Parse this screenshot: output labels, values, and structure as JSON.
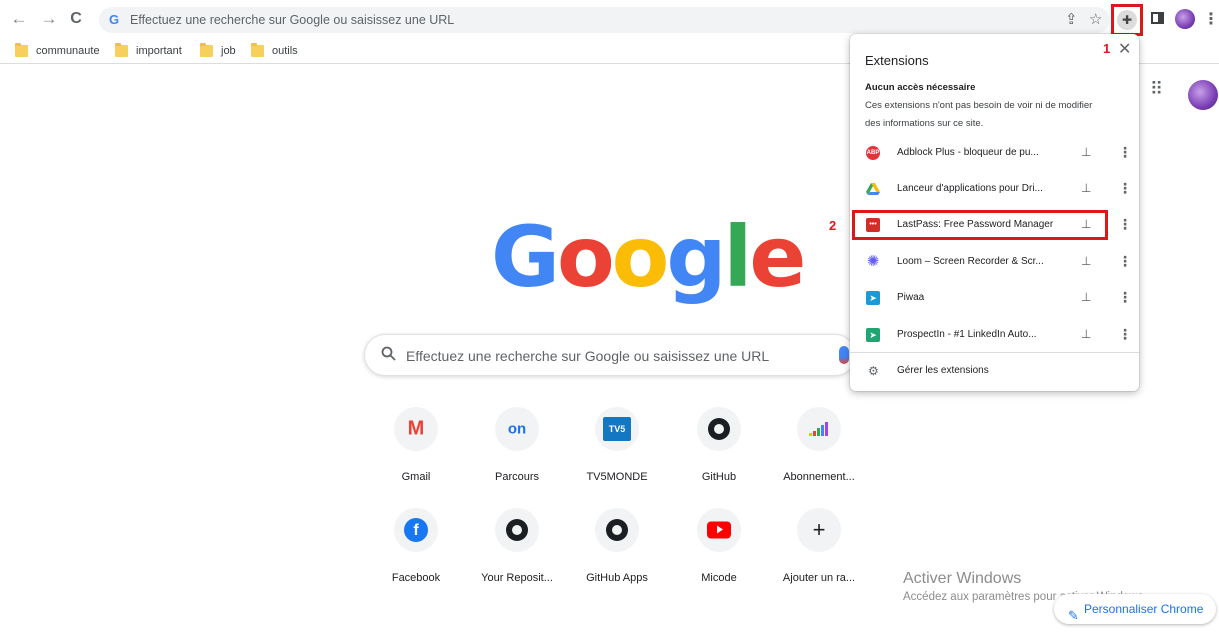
{
  "toolbar": {
    "back": "←",
    "forward": "→",
    "reload": "C",
    "omnibox_placeholder": "Effectuez une recherche sur Google ou saisissez une URL",
    "share": "⇪",
    "bookmark_star": "☆",
    "menu": "⋮"
  },
  "bookmarks": [
    {
      "label": "communaute"
    },
    {
      "label": "important"
    },
    {
      "label": "job"
    },
    {
      "label": "outils"
    }
  ],
  "google": {
    "logo": [
      "G",
      "o",
      "o",
      "g",
      "l",
      "e"
    ],
    "logo_colors": [
      "#4285f4",
      "#ea4335",
      "#fbbc05",
      "#4285f4",
      "#34a853",
      "#ea4335"
    ],
    "search_placeholder": "Effectuez une recherche sur Google ou saisissez une URL"
  },
  "shortcuts": [
    {
      "label": "Gmail",
      "icon": "gmail-icon",
      "text": "M"
    },
    {
      "label": "Parcours",
      "icon": "openclassrooms-icon",
      "text": "on"
    },
    {
      "label": "TV5MONDE",
      "icon": "tv5monde-icon",
      "text": "TV5"
    },
    {
      "label": "GitHub",
      "icon": "github-icon"
    },
    {
      "label": "Abonnement...",
      "icon": "deezer-icon"
    },
    {
      "label": "Facebook",
      "icon": "facebook-icon",
      "text": "f"
    },
    {
      "label": "Your Reposit...",
      "icon": "github-icon"
    },
    {
      "label": "GitHub Apps",
      "icon": "github-icon"
    },
    {
      "label": "Micode",
      "icon": "youtube-icon"
    },
    {
      "label": "Ajouter un ra...",
      "icon": "plus-icon",
      "text": "+"
    }
  ],
  "extensions_popup": {
    "title": "Extensions",
    "close": "✕",
    "section_title": "Aucun accès nécessaire",
    "section_desc": "Ces extensions n'ont pas besoin de voir ni de modifier des informations sur ce site.",
    "items": [
      {
        "name": "Adblock Plus - bloqueur de pu...",
        "icon": "adblock-icon",
        "badge": "ABP"
      },
      {
        "name": "Lanceur d'applications pour Dri...",
        "icon": "google-drive-icon"
      },
      {
        "name": "LastPass: Free Password Manager",
        "icon": "lastpass-icon",
        "badge": "•••"
      },
      {
        "name": "Loom – Screen Recorder & Scr...",
        "icon": "loom-icon"
      },
      {
        "name": "Piwaa",
        "icon": "piwaa-icon"
      },
      {
        "name": "ProspectIn - #1 LinkedIn Auto...",
        "icon": "prospectin-icon"
      }
    ],
    "manage_label": "Gérer les extensions"
  },
  "annotations": {
    "num1": "1",
    "num2": "2"
  },
  "watermark": {
    "title": "Activer Windows",
    "subtitle": "Accédez aux paramètres pour activer Windows."
  },
  "customize_label": "Personnaliser Chrome",
  "colors": {
    "accent": "#1a73e8",
    "annotation_red": "#e0161d"
  }
}
